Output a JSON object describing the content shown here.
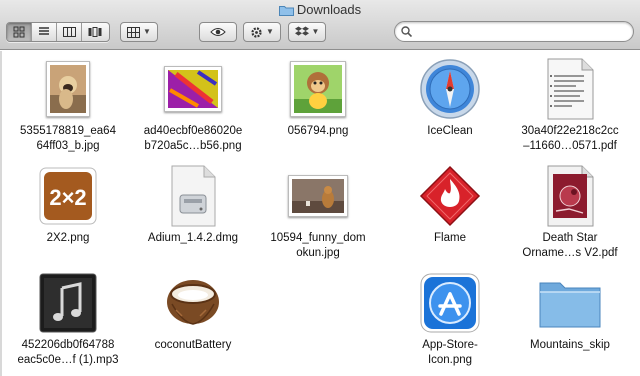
{
  "window": {
    "title": "Downloads",
    "title_icon": "folder-icon"
  },
  "toolbar": {
    "view_modes": [
      "icon-view",
      "list-view",
      "column-view",
      "cover-flow-view"
    ],
    "active_view": "icon-view",
    "arrange_icon": "arrange-grid-icon",
    "quicklook_icon": "eye-icon",
    "action_icon": "gear-icon",
    "share_icon": "dropbox-icon"
  },
  "search": {
    "value": "",
    "placeholder": ""
  },
  "files": [
    {
      "line1": "5355178819_ea64",
      "line2": "64ff03_b.jpg",
      "icon": "pug-photo-thumbnail"
    },
    {
      "line1": "ad40ecbf0e86020e",
      "line2": "b720a5c…b56.png",
      "icon": "colorful-image-thumbnail"
    },
    {
      "line1": "056794.png",
      "line2": "",
      "icon": "monkey-game-thumbnail"
    },
    {
      "line1": "IceClean",
      "line2": "",
      "icon": "iceclean-compass-icon"
    },
    {
      "line1": "30a40f22e218c2cc",
      "line2": "–11660…0571.pdf",
      "icon": "pdf-document-icon"
    },
    {
      "line1": "2X2.png",
      "line2": "",
      "icon": "2x2-tile-icon"
    },
    {
      "line1": "Adium_1.4.2.dmg",
      "line2": "",
      "icon": "disk-image-icon"
    },
    {
      "line1": "10594_funny_dom",
      "line2": "okun.jpg",
      "icon": "brown-photo-thumbnail"
    },
    {
      "line1": "Flame",
      "line2": "",
      "icon": "flame-app-icon"
    },
    {
      "line1": "Death Star",
      "line2": "Orname…s V2.pdf",
      "icon": "red-pdf-document-icon"
    },
    {
      "line1": "452206db0f64788",
      "line2": "eac5c0e…f (1).mp3",
      "icon": "music-note-icon"
    },
    {
      "line1": "coconutBattery",
      "line2": "",
      "icon": "coconut-icon"
    },
    {
      "line1": "",
      "line2": "",
      "icon": ""
    },
    {
      "line1": "App-Store-",
      "line2": "Icon.png",
      "icon": "app-store-icon"
    },
    {
      "line1": "Mountains_skip",
      "line2": "",
      "icon": "blue-folder-icon"
    }
  ],
  "colors": {
    "toolbar_top": "#e8e8e8",
    "toolbar_bottom": "#c9c9c9",
    "folder_blue": "#79b4e3",
    "flame_red": "#d8222a"
  }
}
